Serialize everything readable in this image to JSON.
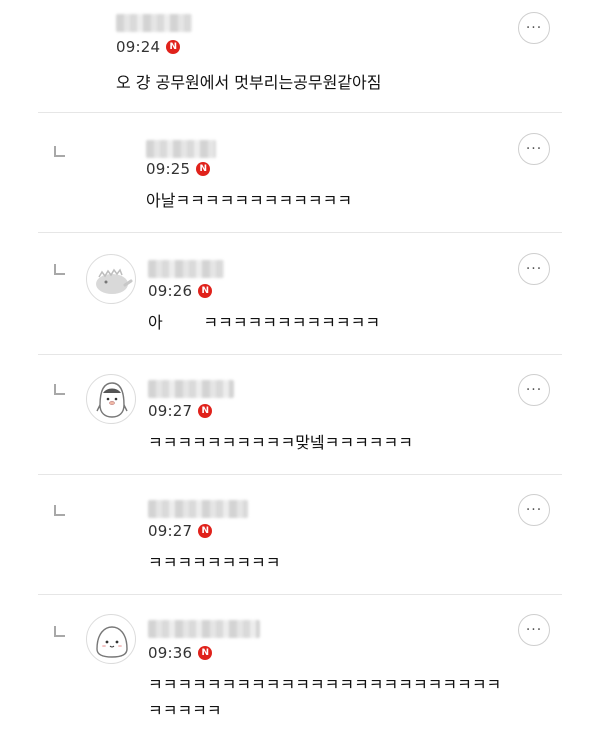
{
  "badge_letter": "N",
  "more_glyph": "···",
  "comments": [
    {
      "time": "09:24",
      "text": "오 걍 공무원에서 멋부리는공무원같아짐",
      "reply": false,
      "avatar": "none"
    },
    {
      "time": "09:25",
      "text": "아날ㅋㅋㅋㅋㅋㅋㅋㅋㅋㅋㅋㅋ",
      "reply": true,
      "avatar": "none"
    },
    {
      "time": "09:26",
      "text": "아        ㅋㅋㅋㅋㅋㅋㅋㅋㅋㅋㅋㅋ",
      "reply": true,
      "avatar": "dinosaur-icon"
    },
    {
      "time": "09:27",
      "text": "ㅋㅋㅋㅋㅋㅋㅋㅋㅋㅋ맞넼ㅋㅋㅋㅋㅋㅋ",
      "reply": true,
      "avatar": "penguin-icon"
    },
    {
      "time": "09:27",
      "text": "ㅋㅋㅋㅋㅋㅋㅋㅋㅋ",
      "reply": true,
      "avatar": "none"
    },
    {
      "time": "09:36",
      "text": "ㅋㅋㅋㅋㅋㅋㅋㅋㅋㅋㅋㅋㅋㅋㅋㅋㅋㅋㅋㅋㅋㅋㅋㅋ\nㅋㅋㅋㅋㅋ",
      "reply": true,
      "avatar": "bun-face-icon"
    }
  ],
  "colors": {
    "badge": "#e0221b",
    "divider": "#e6e6e6",
    "text": "#111111"
  }
}
